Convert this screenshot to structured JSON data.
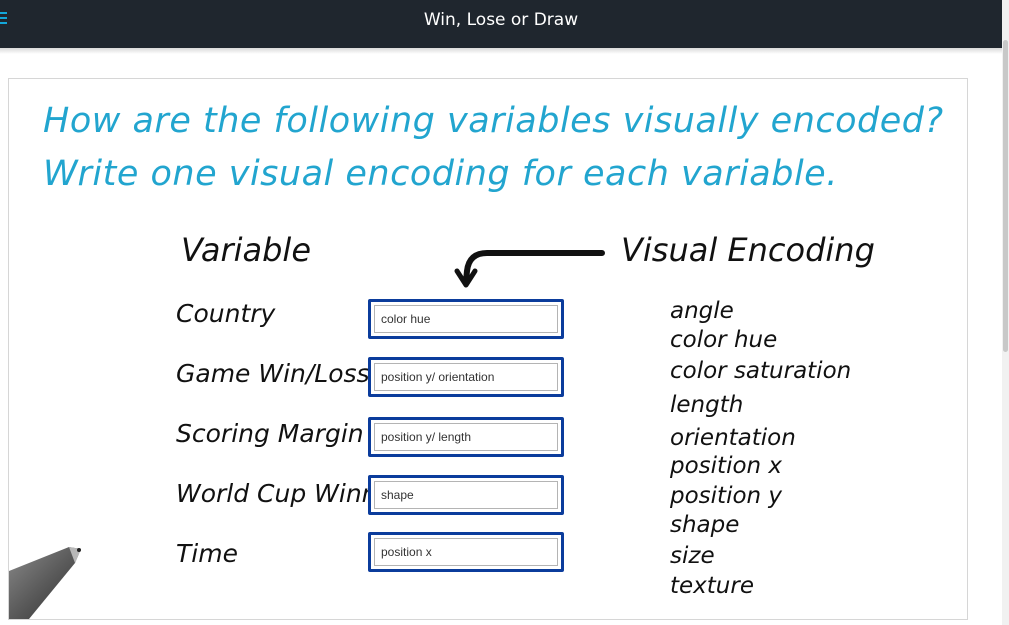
{
  "topbar": {
    "title": "Win, Lose or Draw",
    "menu_icon": "hamburger-icon",
    "accent": "#13a6d8"
  },
  "question": {
    "line1": "How are the following variables visually encoded?",
    "line2": "Write one visual encoding for each variable."
  },
  "columns": {
    "variable_heading": "Variable",
    "encoding_heading": "Visual Encoding"
  },
  "variables": [
    {
      "label": "Country",
      "answer": "color hue"
    },
    {
      "label": "Game Win/Loss",
      "answer": "position y/ orientation"
    },
    {
      "label": "Scoring Margin",
      "answer": "position y/ length"
    },
    {
      "label": "World Cup Winner",
      "answer": "shape"
    },
    {
      "label": "Time",
      "answer": "position x"
    }
  ],
  "encodings": [
    "angle",
    "color hue",
    "color saturation",
    "length",
    "orientation",
    "position x",
    "position y",
    "shape",
    "size",
    "texture"
  ],
  "colors": {
    "heading": "#22a5cf",
    "box_border": "#0b3c9c",
    "topbar": "#1f262e"
  }
}
